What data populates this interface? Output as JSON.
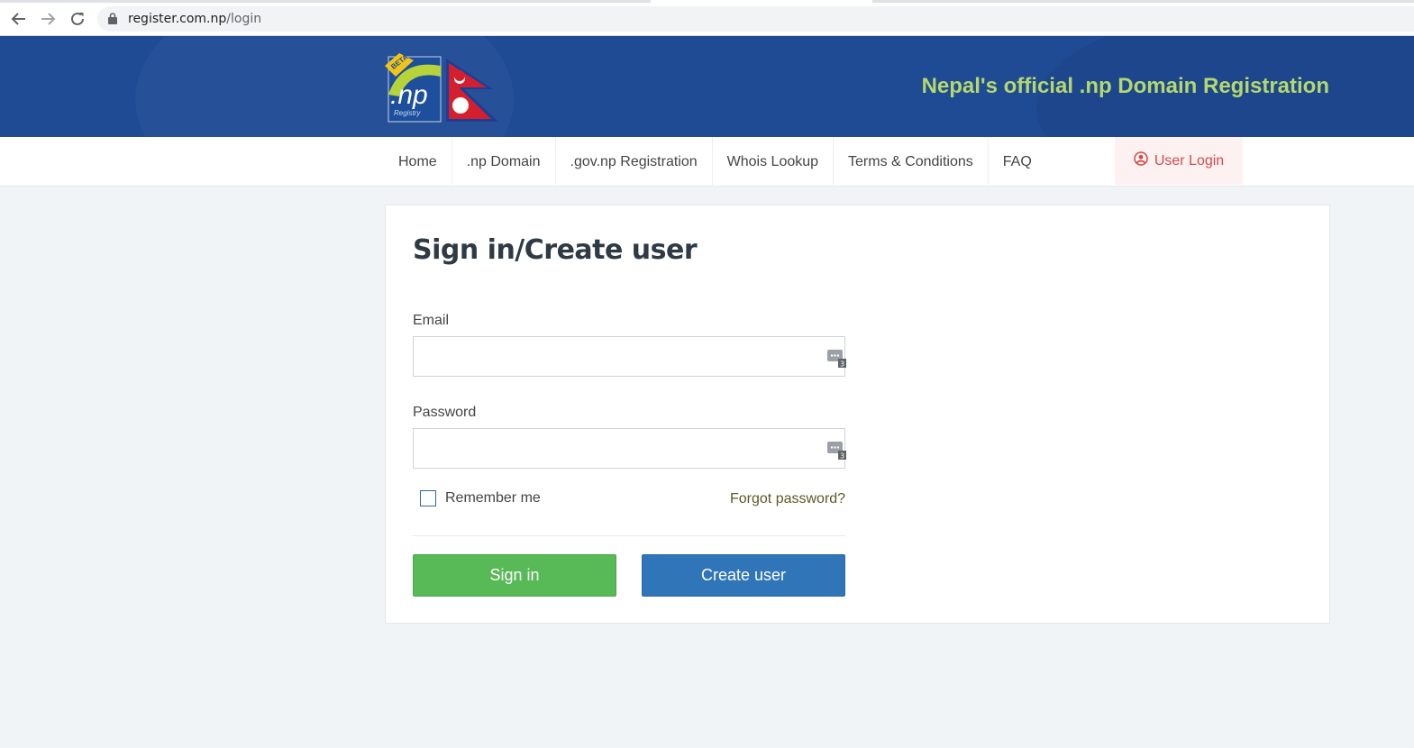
{
  "browser": {
    "url_host": "register.com.np",
    "url_path": "/login"
  },
  "header": {
    "logo": {
      "text": ".np",
      "badge": "BETA",
      "sub": "Registry"
    },
    "tagline": "Nepal's official .np Domain Registration"
  },
  "nav": {
    "items": [
      {
        "label": "Home"
      },
      {
        "label": ".np Domain"
      },
      {
        "label": ".gov.np Registration"
      },
      {
        "label": "Whois Lookup"
      },
      {
        "label": "Terms & Conditions"
      },
      {
        "label": "FAQ"
      }
    ],
    "user_login": "User Login"
  },
  "form": {
    "title": "Sign in/Create user",
    "email_label": "Email",
    "email_value": "",
    "password_label": "Password",
    "password_value": "",
    "password_manager_badge": "3",
    "remember_label": "Remember me",
    "remember_checked": false,
    "forgot_label": "Forgot password?",
    "signin_label": "Sign in",
    "create_label": "Create user"
  },
  "colors": {
    "header_bg": "#1f4a94",
    "tagline": "#b4d86d",
    "signin": "#58b957",
    "create": "#2f75b8",
    "user_login": "#d24b4b"
  }
}
